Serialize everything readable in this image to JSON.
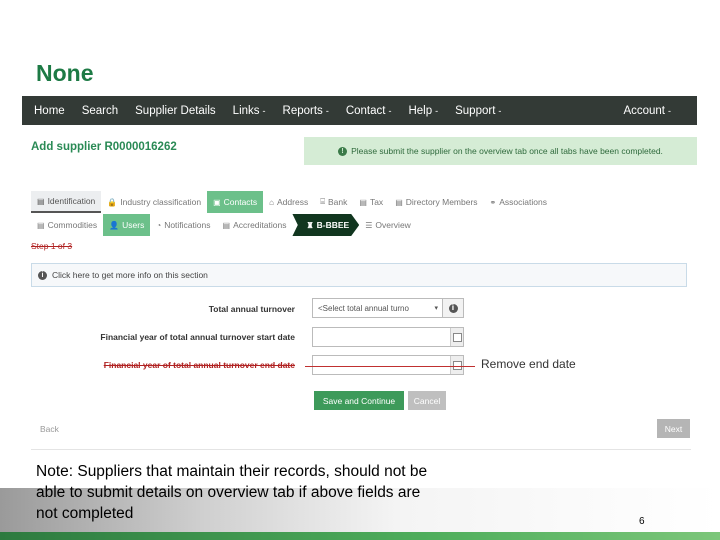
{
  "slide_title": "None",
  "navbar": {
    "items": [
      {
        "label": "Home",
        "caret": ""
      },
      {
        "label": "Search",
        "caret": ""
      },
      {
        "label": "Supplier Details",
        "caret": ""
      },
      {
        "label": "Links",
        "caret": "-"
      },
      {
        "label": "Reports",
        "caret": "-"
      },
      {
        "label": "Contact",
        "caret": "-"
      },
      {
        "label": "Help",
        "caret": "-"
      },
      {
        "label": "Support",
        "caret": "-"
      }
    ],
    "account": {
      "label": "Account",
      "caret": "-"
    }
  },
  "page_heading": "Add supplier R0000016262",
  "alert_text": "Please submit the supplier on the overview tab once all tabs have been completed.",
  "tabs_row1": [
    {
      "label": "Identification",
      "state": "first"
    },
    {
      "label": "Industry classification",
      "state": "plain"
    },
    {
      "label": "Contacts",
      "state": "done"
    },
    {
      "label": "Address",
      "state": "plain"
    },
    {
      "label": "Bank",
      "state": "plain"
    },
    {
      "label": "Tax",
      "state": "plain"
    },
    {
      "label": "Directory Members",
      "state": "plain"
    },
    {
      "label": "Associations",
      "state": "plain"
    }
  ],
  "tabs_row2": [
    {
      "label": "Commodities",
      "state": "plain"
    },
    {
      "label": "Users",
      "state": "done"
    },
    {
      "label": "Notifications",
      "state": "plain"
    },
    {
      "label": "Accreditations",
      "state": "plain"
    },
    {
      "label": "B-BBEE",
      "state": "active"
    },
    {
      "label": "Overview",
      "state": "plain"
    }
  ],
  "step_text": "Step 1 of 3",
  "info_bar_text": "Click here to get more info on this section",
  "form": {
    "turnover_label": "Total annual turnover",
    "turnover_select_value": "<Select total annual turno",
    "start_label": "Financial year of total annual turnover start date",
    "end_label": "Financial year of total annual turnover end date",
    "start_value": "",
    "end_value": ""
  },
  "annotation": "Remove end date",
  "buttons": {
    "save": "Save and Continue",
    "cancel": "Cancel",
    "back": "Back",
    "next": "Next"
  },
  "note": "Note: Suppliers that maintain their records, should not be able to submit details on overview tab if above fields are not completed",
  "page_number": "6",
  "colors": {
    "title_green": "#1d7a45",
    "navbar": "#333a36",
    "tab_done": "#6cc08a",
    "tab_active": "#11361f",
    "save_button": "#3d9a5a",
    "strike_red": "#b02222"
  }
}
